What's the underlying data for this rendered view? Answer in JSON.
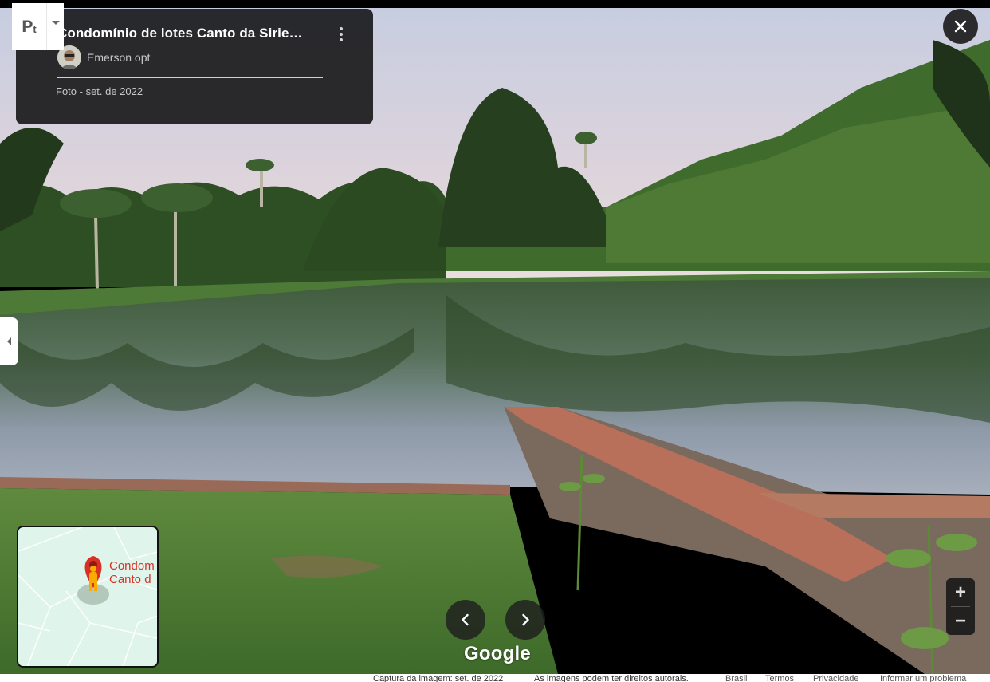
{
  "app_switch": {
    "icon": "pt-icon",
    "main_label": "P",
    "sub_label": "t"
  },
  "card": {
    "title": "Condomínio de lotes Canto da Sirie…",
    "author": "Emerson opt",
    "date": "Foto - set. de 2022"
  },
  "minimap": {
    "label_line1": "Condom",
    "label_line2": "Canto d"
  },
  "logo": "Google",
  "zoom": {
    "in_label": "+",
    "out_label": "−"
  },
  "footer": {
    "capture": "Captura da imagem: set. de 2022",
    "copyright": "As imagens podem ter direitos autorais.",
    "country": "Brasil",
    "terms": "Termos",
    "privacy": "Privacidade",
    "report": "Informar um problema"
  },
  "colors": {
    "brand_red": "#d93025",
    "card_bg": "#1c1c1e",
    "map_bg": "#dff4ea"
  }
}
